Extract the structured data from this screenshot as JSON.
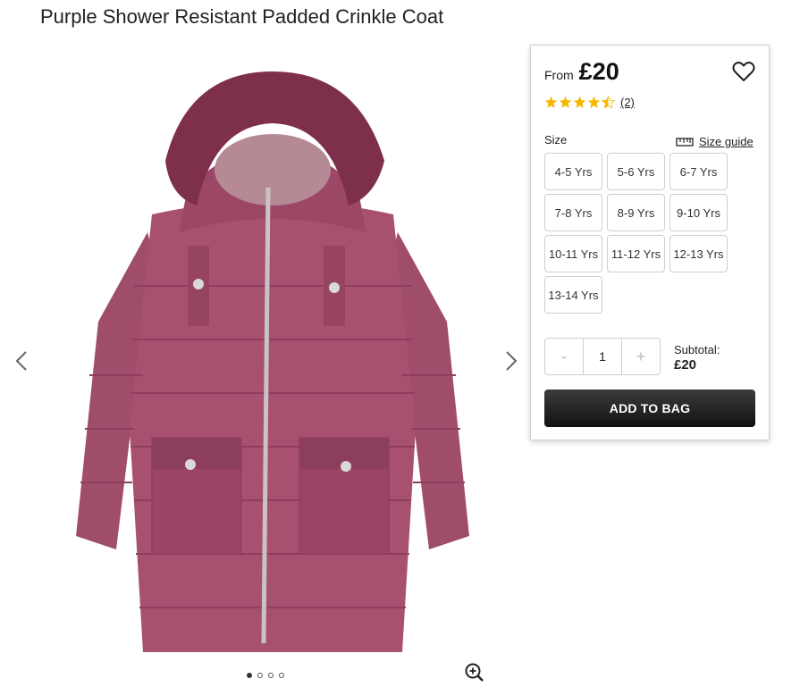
{
  "product": {
    "title": "Purple Shower Resistant Padded Crinkle Coat"
  },
  "gallery": {
    "image_count": 4,
    "active_index": 0,
    "icons": [
      "chevron-left-icon",
      "chevron-right-icon",
      "zoom-in-icon"
    ]
  },
  "panel": {
    "from_label": "From",
    "price": "£20",
    "rating_value": 4.5,
    "rating_count": "(2)",
    "size_label": "Size",
    "size_guide_label": "Size guide",
    "sizes": [
      "4-5 Yrs",
      "5-6 Yrs",
      "6-7 Yrs",
      "7-8 Yrs",
      "8-9 Yrs",
      "9-10 Yrs",
      "10-11 Yrs",
      "11-12 Yrs",
      "12-13 Yrs",
      "13-14 Yrs"
    ],
    "quantity": "1",
    "minus_label": "-",
    "plus_label": "+",
    "subtotal_label": "Subtotal:",
    "subtotal_value": "£20",
    "add_to_bag_label": "ADD TO BAG"
  },
  "colors": {
    "coat": "#a8506f",
    "fur": "#7d2f4c",
    "star": "#f5b800",
    "button_dark": "#1a1a1a"
  }
}
